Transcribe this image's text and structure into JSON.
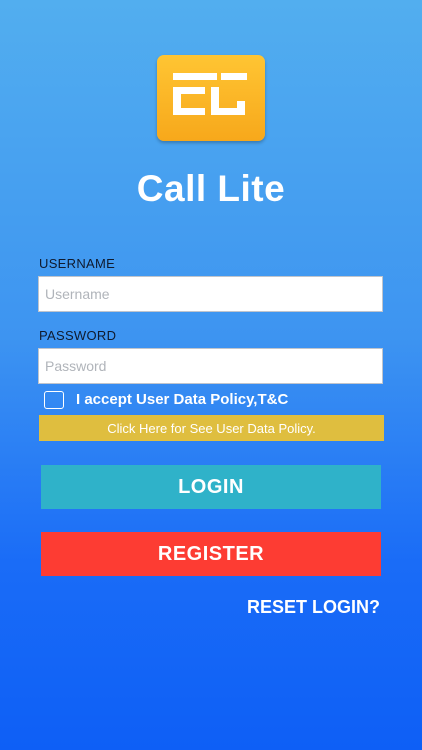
{
  "app": {
    "logo_text": "CL",
    "name": "Call Lite"
  },
  "form": {
    "username_label": "USERNAME",
    "username_placeholder": "Username",
    "username_value": "",
    "password_label": "PASSWORD",
    "password_placeholder": "Password",
    "password_value": "",
    "accept_label": "I accept User Data Policy,T&C",
    "accept_checked": false,
    "policy_link": "Click Here for See User Data Policy."
  },
  "buttons": {
    "login": "LOGIN",
    "register": "REGISTER",
    "reset": "RESET LOGIN?"
  },
  "colors": {
    "background_top": "#52aeef",
    "background_bottom": "#0e5ff6",
    "logo_tile": "#f7a81b",
    "policy_bar": "#dfbe3f",
    "login_button": "#2fb2c9",
    "register_button": "#fd3c33"
  }
}
